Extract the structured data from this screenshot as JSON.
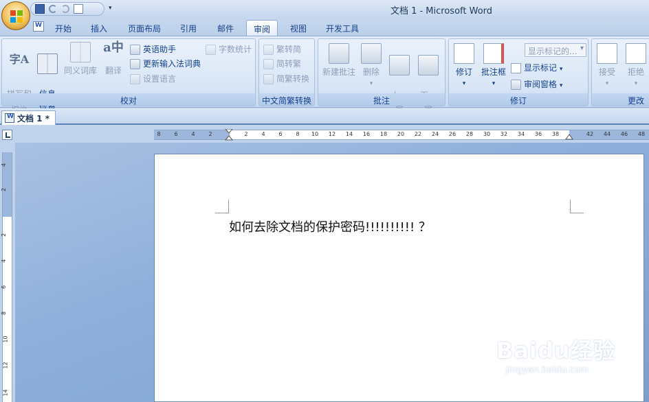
{
  "window": {
    "title": "文档 1 - Microsoft Word"
  },
  "tabs": [
    "开始",
    "插入",
    "页面布局",
    "引用",
    "邮件",
    "审阅",
    "视图",
    "开发工具"
  ],
  "active_tab": "审阅",
  "ribbon": {
    "proofing": {
      "label": "校对",
      "spelling": "拼写和\n语法",
      "research": "信息\n检索",
      "thesaurus": "同义词库",
      "translate": "翻译",
      "english_assistant": "英语助手",
      "update_ime": "更新输入法词典",
      "set_language": "设置语言",
      "word_count": "字数统计"
    },
    "chinese_conversion": {
      "label": "中文简繁转换",
      "to_simplified": "繁转简",
      "to_traditional": "简转繁",
      "convert": "简繁转换"
    },
    "comments": {
      "label": "批注",
      "new_comment": "新建批注",
      "delete": "删除",
      "previous": "上一\n条",
      "next": "下一\n条"
    },
    "tracking": {
      "label": "修订",
      "track_changes": "修订",
      "balloons": "批注框",
      "display_dropdown": "显示标记的...",
      "show_markup": "显示标记",
      "reviewing_pane": "审阅窗格"
    },
    "changes": {
      "label": "更改",
      "accept": "接受",
      "reject": "拒绝"
    }
  },
  "document_tab": "文档 1 *",
  "ruler": {
    "h_ticks": [
      "8",
      "6",
      "4",
      "2",
      "2",
      "4",
      "6",
      "8",
      "10",
      "12",
      "14",
      "16",
      "18",
      "20",
      "22",
      "24",
      "26",
      "28",
      "30",
      "32",
      "34",
      "36",
      "38",
      "42",
      "44",
      "46",
      "48"
    ],
    "v_ticks": [
      "4",
      "2",
      "2",
      "4",
      "6",
      "8",
      "10",
      "12",
      "14"
    ]
  },
  "document": {
    "text": "如何去除文档的保护密码!!!!!!!!!! ？"
  },
  "watermark": {
    "main": "Baidu经验",
    "sub": "jingyan.baidu.com"
  }
}
